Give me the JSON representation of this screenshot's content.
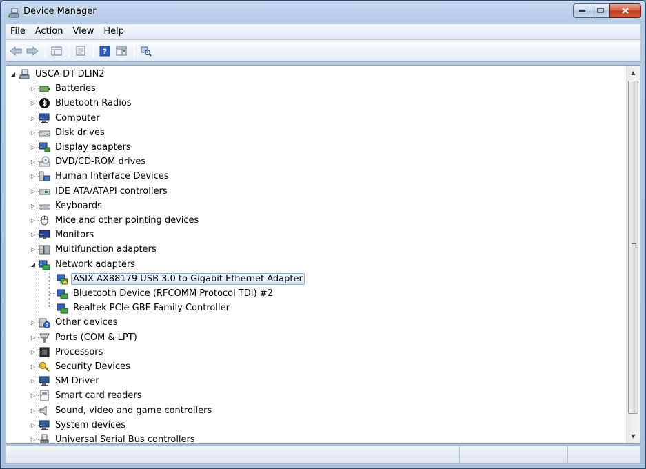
{
  "window": {
    "title": "Device Manager"
  },
  "menu": [
    "File",
    "Action",
    "View",
    "Help"
  ],
  "toolbar": {
    "buttons": [
      "back-arrow-icon",
      "forward-arrow-icon",
      "properties-grid-icon",
      "show-hidden-icon",
      "help-icon",
      "action-pane-icon",
      "scan-hardware-icon"
    ]
  },
  "tree": {
    "root": "USCA-DT-DLIN2",
    "categories": [
      {
        "label": "Batteries",
        "icon": "battery-icon"
      },
      {
        "label": "Bluetooth Radios",
        "icon": "bluetooth-icon"
      },
      {
        "label": "Computer",
        "icon": "computer-icon"
      },
      {
        "label": "Disk drives",
        "icon": "disk-drive-icon"
      },
      {
        "label": "Display adapters",
        "icon": "display-adapter-icon"
      },
      {
        "label": "DVD/CD-ROM drives",
        "icon": "dvd-drive-icon"
      },
      {
        "label": "Human Interface Devices",
        "icon": "hid-icon"
      },
      {
        "label": "IDE ATA/ATAPI controllers",
        "icon": "ide-controller-icon"
      },
      {
        "label": "Keyboards",
        "icon": "keyboard-icon"
      },
      {
        "label": "Mice and other pointing devices",
        "icon": "mouse-icon"
      },
      {
        "label": "Monitors",
        "icon": "monitor-icon"
      },
      {
        "label": "Multifunction adapters",
        "icon": "multifunction-icon"
      },
      {
        "label": "Network adapters",
        "icon": "network-adapter-icon",
        "expanded": true,
        "children": [
          {
            "label": "ASIX AX88179 USB 3.0 to Gigabit Ethernet Adapter",
            "icon": "network-warning-icon",
            "selected": true
          },
          {
            "label": "Bluetooth Device (RFCOMM Protocol TDI) #2",
            "icon": "network-adapter-icon"
          },
          {
            "label": "Realtek PCIe GBE Family Controller",
            "icon": "network-adapter-icon"
          }
        ]
      },
      {
        "label": "Other devices",
        "icon": "unknown-device-icon"
      },
      {
        "label": "Ports (COM & LPT)",
        "icon": "port-icon"
      },
      {
        "label": "Processors",
        "icon": "processor-icon"
      },
      {
        "label": "Security Devices",
        "icon": "security-key-icon"
      },
      {
        "label": "SM Driver",
        "icon": "computer-icon"
      },
      {
        "label": "Smart card readers",
        "icon": "smart-card-icon"
      },
      {
        "label": "Sound, video and game controllers",
        "icon": "speaker-icon"
      },
      {
        "label": "System devices",
        "icon": "computer-icon"
      },
      {
        "label": "Universal Serial Bus controllers",
        "icon": "usb-icon"
      }
    ]
  },
  "colors": {
    "selection_border": "#84acdd",
    "title_gradient": "#c6d9ef",
    "close_button": "#c4361b"
  }
}
